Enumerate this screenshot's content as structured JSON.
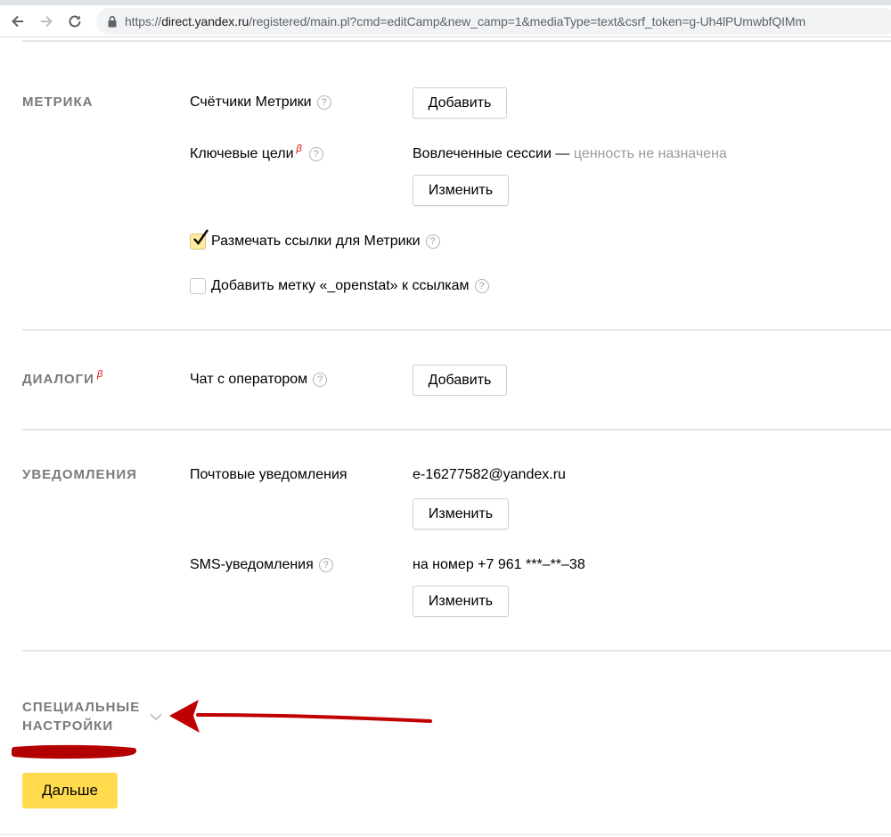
{
  "browser": {
    "url_prefix": "https://",
    "url_host": "direct.yandex.ru",
    "url_rest": "/registered/main.pl?cmd=editCamp&new_camp=1&mediaType=text&csrf_token=g-Uh4lPUmwbfQIMm"
  },
  "metrika": {
    "title": "МЕТРИКА",
    "counters_label": "Счётчики Метрики",
    "counters_button": "Добавить",
    "goals_label": "Ключевые цели",
    "goals_beta": "β",
    "goals_value": "Вовлеченные сессии —",
    "goals_value_muted": "ценность не назначена",
    "goals_button": "Изменить",
    "mark_links_label": "Размечать ссылки для Метрики",
    "mark_links_checked": true,
    "openstat_label": "Добавить метку «_openstat» к ссылкам",
    "openstat_checked": false
  },
  "dialogs": {
    "title": "ДИАЛОГИ",
    "beta": "β",
    "chat_label": "Чат с оператором",
    "chat_button": "Добавить"
  },
  "notifications": {
    "title": "УВЕДОМЛЕНИЯ",
    "email_label": "Почтовые уведомления",
    "email_value": "e-16277582@yandex.ru",
    "email_button": "Изменить",
    "sms_label": "SMS-уведомления",
    "sms_value": "на номер +7 961 ***–**–38",
    "sms_button": "Изменить"
  },
  "special": {
    "title_line1": "СПЕЦИАЛЬНЫЕ",
    "title_line2": "НАСТРОЙКИ"
  },
  "next_button": "Дальше",
  "help_glyph": "?",
  "colors": {
    "accent_yellow": "#ffdb4d",
    "beta_red": "#e00000",
    "annotation_red": "#c00000",
    "section_gray": "#7a7a7a"
  }
}
